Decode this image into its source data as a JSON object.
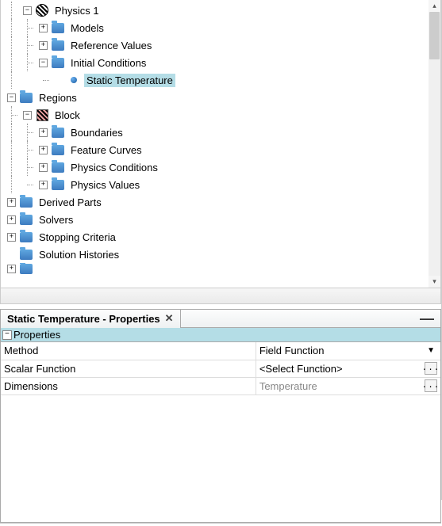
{
  "tree": {
    "physics1": "Physics 1",
    "models": "Models",
    "refvals": "Reference Values",
    "initcond": "Initial Conditions",
    "statictemp": "Static Temperature",
    "regions": "Regions",
    "block": "Block",
    "boundaries": "Boundaries",
    "featurecurves": "Feature Curves",
    "physcond": "Physics Conditions",
    "physvals": "Physics Values",
    "derived": "Derived Parts",
    "solvers": "Solvers",
    "stopcrit": "Stopping Criteria",
    "solhist": "Solution Histories"
  },
  "panel": {
    "tab_title": "Static Temperature - Properties",
    "group": "Properties",
    "rows": {
      "method_label": "Method",
      "method_value": "Field Function",
      "scalar_label": "Scalar Function",
      "scalar_value": "<Select Function>",
      "dims_label": "Dimensions",
      "dims_value": "Temperature"
    }
  },
  "glyph": {
    "plus": "+",
    "minus": "−",
    "close": "✕",
    "caret": "▼",
    "ellipsis": "...",
    "dash": "—"
  }
}
